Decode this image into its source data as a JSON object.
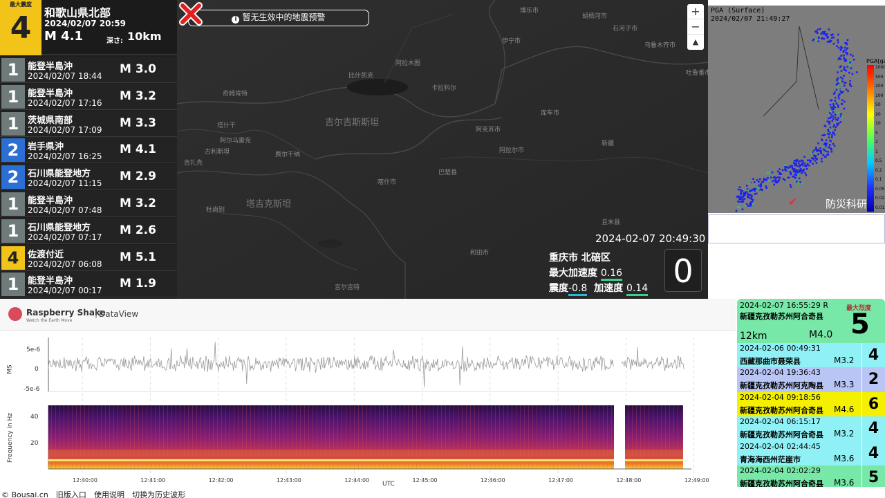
{
  "latest": {
    "intensity_label": "最大震度",
    "intensity": "4",
    "region": "和歌山県北部",
    "time": "2024/02/07 20:59",
    "magnitude": "M 4.1",
    "depth_label": "深さ:",
    "depth": "10km"
  },
  "quakes": [
    {
      "intensity": "1",
      "color": "#6f7a7a",
      "region": "能登半島沖",
      "time": "2024/02/07 18:44",
      "mag": "M 3.0"
    },
    {
      "intensity": "1",
      "color": "#6f7a7a",
      "region": "能登半島沖",
      "time": "2024/02/07 17:16",
      "mag": "M 3.2"
    },
    {
      "intensity": "1",
      "color": "#6f7a7a",
      "region": "茨城県南部",
      "time": "2024/02/07 17:09",
      "mag": "M 3.3"
    },
    {
      "intensity": "2",
      "color": "#2c6fd4",
      "region": "岩手県沖",
      "time": "2024/02/07 16:25",
      "mag": "M 4.1"
    },
    {
      "intensity": "2",
      "color": "#2c6fd4",
      "region": "石川県能登地方",
      "time": "2024/02/07 11:15",
      "mag": "M 2.9"
    },
    {
      "intensity": "1",
      "color": "#6f7a7a",
      "region": "能登半島沖",
      "time": "2024/02/07 07:48",
      "mag": "M 3.2"
    },
    {
      "intensity": "1",
      "color": "#6f7a7a",
      "region": "石川県能登地方",
      "time": "2024/02/07 07:17",
      "mag": "M 2.6"
    },
    {
      "intensity": "4",
      "color": "#f2c318",
      "region": "佐渡付近",
      "time": "2024/02/07 06:08",
      "mag": "M 5.1"
    },
    {
      "intensity": "1",
      "color": "#6f7a7a",
      "region": "能登半島沖",
      "time": "2024/02/07 00:17",
      "mag": "M 1.9"
    }
  ],
  "map": {
    "notice": "暂无生效中的地震预警",
    "zoom_in": "+",
    "zoom_out": "−",
    "compass": "▲",
    "labels": [
      {
        "text": "博乐市",
        "x": 496,
        "y": 8
      },
      {
        "text": "胡杨河市",
        "x": 586,
        "y": 16
      },
      {
        "text": "石河子市",
        "x": 630,
        "y": 34
      },
      {
        "text": "伊宁市",
        "x": 470,
        "y": 52
      },
      {
        "text": "乌鲁木齐市",
        "x": 676,
        "y": 58
      },
      {
        "text": "阿拉木图",
        "x": 316,
        "y": 84
      },
      {
        "text": "比什凯克",
        "x": 248,
        "y": 102
      },
      {
        "text": "吐鲁番市",
        "x": 736,
        "y": 98
      },
      {
        "text": "卡拉科尔",
        "x": 368,
        "y": 120
      },
      {
        "text": "奇姆肯特",
        "x": 66,
        "y": 128
      },
      {
        "text": "库车市",
        "x": 526,
        "y": 156
      },
      {
        "text": "塔什干",
        "x": 58,
        "y": 174
      },
      {
        "text": "阿克苏市",
        "x": 432,
        "y": 180
      },
      {
        "text": "阿尔马雷克",
        "x": 62,
        "y": 196
      },
      {
        "text": "新疆",
        "x": 614,
        "y": 200
      },
      {
        "text": "古利斯坦",
        "x": 40,
        "y": 212
      },
      {
        "text": "费尔干纳",
        "x": 142,
        "y": 216
      },
      {
        "text": "阿拉尔市",
        "x": 466,
        "y": 210
      },
      {
        "text": "吉扎克",
        "x": 10,
        "y": 228
      },
      {
        "text": "巴楚县",
        "x": 378,
        "y": 242
      },
      {
        "text": "喀什市",
        "x": 290,
        "y": 256
      },
      {
        "text": "杜尚别",
        "x": 42,
        "y": 296
      },
      {
        "text": "且末县",
        "x": 614,
        "y": 314
      },
      {
        "text": "和田市",
        "x": 424,
        "y": 358
      },
      {
        "text": "吉尔吉特",
        "x": 228,
        "y": 408
      }
    ],
    "countries": [
      {
        "text": "吉尔吉斯斯坦",
        "x": 214,
        "y": 166
      },
      {
        "text": "塔吉克斯坦",
        "x": 100,
        "y": 284
      }
    ],
    "epicenter_icon": "cross-icon",
    "station_time": "2024-02-07 20:49:30",
    "station": "重庆市 北碚区",
    "max_acc_label": "最大加速度",
    "max_acc": "0.16",
    "shindo_label": "震度",
    "shindo": "-0.8",
    "acc_label": "加速度",
    "acc": "0.14",
    "big_value": "0"
  },
  "pga": {
    "title": "PGA (Surface)",
    "time": "2024/02/07 21:49:27",
    "unit": "PGA[gal]",
    "ticks": [
      "1000",
      "500",
      "200",
      "100",
      "50",
      "20",
      "10",
      "5",
      "2",
      "1",
      "0.5",
      "0.2",
      "0.1",
      "0.05",
      "0.02",
      "0.01"
    ],
    "logo_icon": "nied-icon",
    "logo_mark": "NIED",
    "logo_text": "防災科研"
  },
  "dataview": {
    "brand": "Raspberry Shake",
    "tagline": "Watch the Earth Move",
    "separator": "|",
    "app": "DataView",
    "y_top": "5e-6",
    "y_mid": "0",
    "y_bot": "-5e-6",
    "y_axis_label": "MS",
    "freq_top": "40",
    "freq_mid": "20",
    "freq_axis_label": "Frequency in Hz",
    "x_ticks": [
      "12:40:00",
      "12:41:00",
      "12:42:00",
      "12:43:00",
      "12:44:00",
      "12:45:00",
      "12:46:00",
      "12:47:00",
      "12:48:00",
      "12:49:00"
    ],
    "x_axis_label": "UTC"
  },
  "recent": {
    "head": {
      "time": "2024-02-07 16:55:29 R",
      "region": "新疆克孜勒苏州阿合奇县",
      "depth": "12km",
      "mag": "M4.0",
      "label": "最大烈度",
      "intensity": "5",
      "color": "#78e8a8"
    },
    "items": [
      {
        "time": "2024-02-06 00:49:31",
        "region": "西藏那曲市聂荣县",
        "mag": "M3.2",
        "intensity": "4",
        "bg": "#8ff0f5",
        "ibg": "#8ff0f5"
      },
      {
        "time": "2024-02-04 19:36:43",
        "region": "新疆克孜勒苏州阿克陶县",
        "mag": "M3.3",
        "intensity": "2",
        "bg": "#b9c6f5",
        "ibg": "#b9c6f5"
      },
      {
        "time": "2024-02-04 09:18:56",
        "region": "新疆克孜勒苏州阿合奇县",
        "mag": "M4.6",
        "intensity": "6",
        "bg": "#f4f000",
        "ibg": "#f4f000"
      },
      {
        "time": "2024-02-04 06:15:17",
        "region": "新疆克孜勒苏州阿合奇县",
        "mag": "M3.2",
        "intensity": "4",
        "bg": "#8ff0f5",
        "ibg": "#8ff0f5"
      },
      {
        "time": "2024-02-04 02:44:45",
        "region": "青海海西州茫崖市",
        "mag": "M3.6",
        "intensity": "4",
        "bg": "#8ff0f5",
        "ibg": "#8ff0f5"
      },
      {
        "time": "2024-02-04 02:02:29",
        "region": "新疆克孜勒苏州阿合奇县",
        "mag": "M3.6",
        "intensity": "5",
        "bg": "#78e8a8",
        "ibg": "#78e8a8"
      }
    ]
  },
  "footer": {
    "copyright": "© Bousai.cn",
    "old_entry": "旧版入口",
    "manual": "使用说明",
    "history": "切换为历史波形"
  }
}
